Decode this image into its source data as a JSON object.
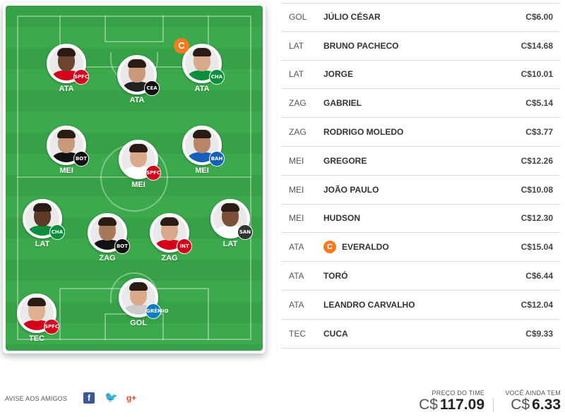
{
  "colors": {
    "field_green": "#37a148",
    "captain_orange": "#f47b20",
    "row_border": "#dcdcdc"
  },
  "captain_letter": "C",
  "field_players": [
    {
      "pos": "ATA",
      "club": "SPFC",
      "club_color": "#d6001c",
      "skin": "#6b4530",
      "shirt": "#d6001c"
    },
    {
      "pos": "ATA",
      "club": "CEA",
      "club_color": "#111111",
      "skin": "#c99a7a",
      "shirt": "#222222"
    },
    {
      "pos": "ATA",
      "club": "CHA",
      "club_color": "#0a8f3c",
      "skin": "#d8a98a",
      "shirt": "#0a8f3c",
      "captain": true
    },
    {
      "pos": "MEI",
      "club": "BOT",
      "club_color": "#111111",
      "skin": "#c99a7a",
      "shirt": "#111111"
    },
    {
      "pos": "MEI",
      "club": "SPFC",
      "club_color": "#d6001c",
      "skin": "#d8a98a",
      "shirt": "#ffffff"
    },
    {
      "pos": "MEI",
      "club": "BAH",
      "club_color": "#1560bd",
      "skin": "#b88566",
      "shirt": "#1560bd"
    },
    {
      "pos": "LAT",
      "club": "CHA",
      "club_color": "#0a8f3c",
      "skin": "#5e3b28",
      "shirt": "#0a8f3c"
    },
    {
      "pos": "ZAG",
      "club": "BOT",
      "club_color": "#111111",
      "skin": "#a9785a",
      "shirt": "#111111"
    },
    {
      "pos": "ZAG",
      "club": "INT",
      "club_color": "#d6001c",
      "skin": "#d8a98a",
      "shirt": "#d6001c"
    },
    {
      "pos": "LAT",
      "club": "SAN",
      "club_color": "#333333",
      "skin": "#7a5038",
      "shirt": "#ffffff"
    },
    {
      "pos": "GOL",
      "club": "GRÊMIO",
      "club_color": "#0d7cc1",
      "skin": "#d8a98a",
      "shirt": "#cccccc"
    },
    {
      "pos": "TEC",
      "club": "SPFC",
      "club_color": "#d6001c",
      "skin": "#e0b190",
      "shirt": "#d6001c"
    }
  ],
  "roster": [
    {
      "pos": "GOL",
      "name": "JÚLIO CÉSAR",
      "price": "C$6.00"
    },
    {
      "pos": "LAT",
      "name": "BRUNO PACHECO",
      "price": "C$14.68"
    },
    {
      "pos": "LAT",
      "name": "JORGE",
      "price": "C$10.01"
    },
    {
      "pos": "ZAG",
      "name": "GABRIEL",
      "price": "C$5.14"
    },
    {
      "pos": "ZAG",
      "name": "RODRIGO MOLEDO",
      "price": "C$3.77"
    },
    {
      "pos": "MEI",
      "name": "GREGORE",
      "price": "C$12.26"
    },
    {
      "pos": "MEI",
      "name": "JOÃO PAULO",
      "price": "C$10.08"
    },
    {
      "pos": "MEI",
      "name": "HUDSON",
      "price": "C$12.30"
    },
    {
      "pos": "ATA",
      "name": "EVERALDO",
      "price": "C$15.04",
      "captain": true
    },
    {
      "pos": "ATA",
      "name": "TORÓ",
      "price": "C$6.44"
    },
    {
      "pos": "ATA",
      "name": "LEANDRO CARVALHO",
      "price": "C$12.04"
    },
    {
      "pos": "TEC",
      "name": "CUCA",
      "price": "C$9.33"
    }
  ],
  "footer": {
    "share_label": "AVISE AOS AMIGOS",
    "share_icons": [
      "facebook-icon",
      "twitter-icon",
      "google-plus-icon"
    ],
    "facebook_glyph": "f",
    "twitter_glyph": "🐦",
    "google_glyph": "g+",
    "team_price_title": "PREÇO DO TIME",
    "team_price_currency": "C$",
    "team_price_value": "117.09",
    "remaining_title": "VOCÊ AINDA TEM",
    "remaining_currency": "C$",
    "remaining_value": "6.33"
  }
}
